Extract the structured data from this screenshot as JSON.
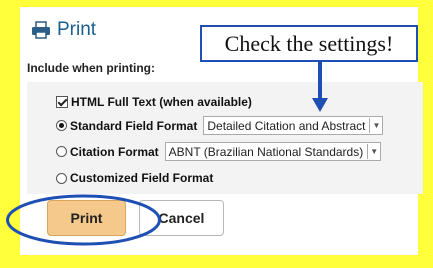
{
  "dialog": {
    "title": "Print",
    "title_icon": "printer-icon",
    "include_label": "Include when printing:",
    "options": {
      "html_full_text": {
        "label": "HTML Full Text (when available)",
        "checked": true
      },
      "standard_field_format": {
        "label": "Standard Field Format",
        "selected": true,
        "select_value": "Detailed Citation and Abstract"
      },
      "citation_format": {
        "label": "Citation Format",
        "selected": false,
        "select_value": "ABNT (Brazilian National Standards)"
      },
      "customized_field_format": {
        "label": "Customized Field Format",
        "selected": false
      }
    },
    "buttons": {
      "print": "Print",
      "cancel": "Cancel"
    }
  },
  "callout": {
    "text": "Check the settings!"
  },
  "colors": {
    "background": "#ffff3c",
    "title": "#1a5f8f",
    "annotation_blue": "#1e4fb4",
    "print_button": "#f5c98c"
  }
}
